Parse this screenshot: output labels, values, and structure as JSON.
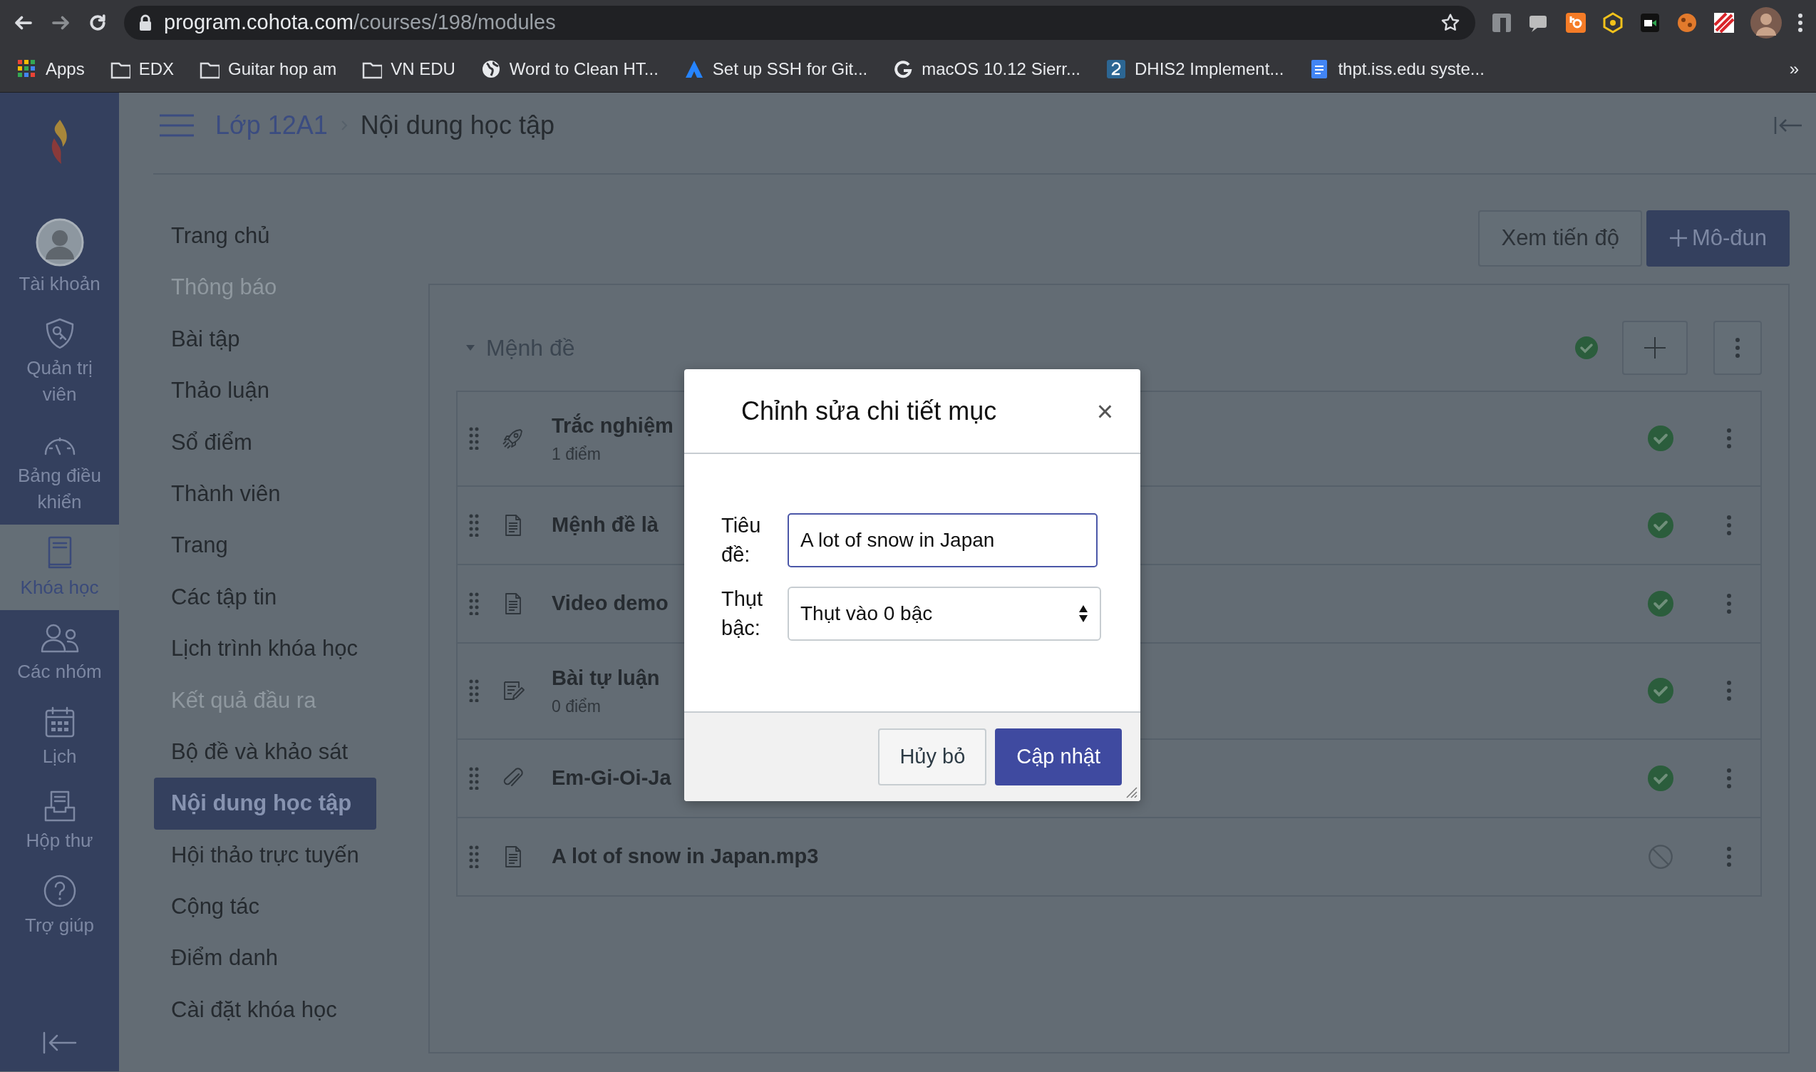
{
  "browser": {
    "url_host": "program.cohota.com",
    "url_path": "/courses/198/modules",
    "bookmarks": [
      {
        "label": "Apps",
        "kind": "apps"
      },
      {
        "label": "EDX",
        "kind": "folder"
      },
      {
        "label": "Guitar hop am",
        "kind": "folder"
      },
      {
        "label": "VN EDU",
        "kind": "folder"
      },
      {
        "label": "Word to Clean HT...",
        "kind": "globe"
      },
      {
        "label": "Set up SSH for Git...",
        "kind": "triangle"
      },
      {
        "label": "macOS 10.12 Sierr...",
        "kind": "g"
      },
      {
        "label": "DHIS2 Implement...",
        "kind": "two"
      },
      {
        "label": "thpt.iss.edu syste...",
        "kind": "doc"
      }
    ],
    "overflow": "»"
  },
  "global_nav": [
    {
      "label": "Tài khoản",
      "kind": "avatar",
      "selected": false
    },
    {
      "label": "Quản trị viên",
      "kind": "shield",
      "selected": false
    },
    {
      "label": "Bảng điều khiển",
      "kind": "gauge",
      "selected": false
    },
    {
      "label": "Khóa học",
      "kind": "book",
      "selected": true
    },
    {
      "label": "Các nhóm",
      "kind": "people",
      "selected": false
    },
    {
      "label": "Lịch",
      "kind": "calendar",
      "selected": false
    },
    {
      "label": "Hộp thư",
      "kind": "inbox",
      "selected": false
    },
    {
      "label": "Trợ giúp",
      "kind": "help",
      "selected": false
    }
  ],
  "breadcrumb": [
    "Lớp 12A1",
    "Nội dung học tập"
  ],
  "course_nav": [
    {
      "label": "Trang chủ",
      "disabled": false,
      "selected": false
    },
    {
      "label": "Thông báo",
      "disabled": true,
      "selected": false
    },
    {
      "label": "Bài tập",
      "disabled": false,
      "selected": false
    },
    {
      "label": "Thảo luận",
      "disabled": false,
      "selected": false
    },
    {
      "label": "Sổ điểm",
      "disabled": false,
      "selected": false
    },
    {
      "label": "Thành viên",
      "disabled": false,
      "selected": false
    },
    {
      "label": "Trang",
      "disabled": false,
      "selected": false
    },
    {
      "label": "Các tập tin",
      "disabled": false,
      "selected": false
    },
    {
      "label": "Lịch trình khóa học",
      "disabled": false,
      "selected": false
    },
    {
      "label": "Kết quả đầu ra",
      "disabled": true,
      "selected": false
    },
    {
      "label": "Bộ đề và khảo sát",
      "disabled": false,
      "selected": false
    },
    {
      "label": "Nội dung học tập",
      "disabled": false,
      "selected": true
    },
    {
      "label": "Hội thảo trực tuyến",
      "disabled": false,
      "selected": false
    },
    {
      "label": "Cộng tác",
      "disabled": false,
      "selected": false
    },
    {
      "label": "Điểm danh",
      "disabled": false,
      "selected": false
    },
    {
      "label": "Cài đặt khóa học",
      "disabled": false,
      "selected": false
    }
  ],
  "actions": [
    {
      "label": "Xem tiến độ",
      "primary": false
    },
    {
      "label": "Mô-đun",
      "primary": true
    }
  ],
  "module": {
    "title": "Mệnh đề",
    "expanded": true,
    "published": true,
    "items": [
      {
        "title": "Trắc nghiệm",
        "kind": "quiz",
        "points": "1 điểm",
        "published": true
      },
      {
        "title": "Mệnh đề là",
        "kind": "page",
        "published": true
      },
      {
        "title": "Video demo",
        "kind": "page",
        "published": true
      },
      {
        "title": "Bài tự luận",
        "kind": "assignment",
        "points": "0 điểm",
        "published": true
      },
      {
        "title": "Em-Gi-Oi-Ja",
        "kind": "attachment",
        "published": true
      },
      {
        "title": "A lot of snow in Japan.mp3",
        "kind": "page",
        "published": false
      }
    ]
  },
  "dialog": {
    "title": "Chỉnh sửa chi tiết mục",
    "close": "×",
    "fields": [
      {
        "label": "Tiêu đề:",
        "kind": "text",
        "value": "A lot of snow in Japan"
      },
      {
        "label": "Thụt bậc:",
        "kind": "select",
        "value": "Thụt vào 0 bậc"
      }
    ],
    "buttons": [
      {
        "label": "Hủy bỏ",
        "primary": false
      },
      {
        "label": "Cập nhật",
        "primary": true
      }
    ]
  }
}
